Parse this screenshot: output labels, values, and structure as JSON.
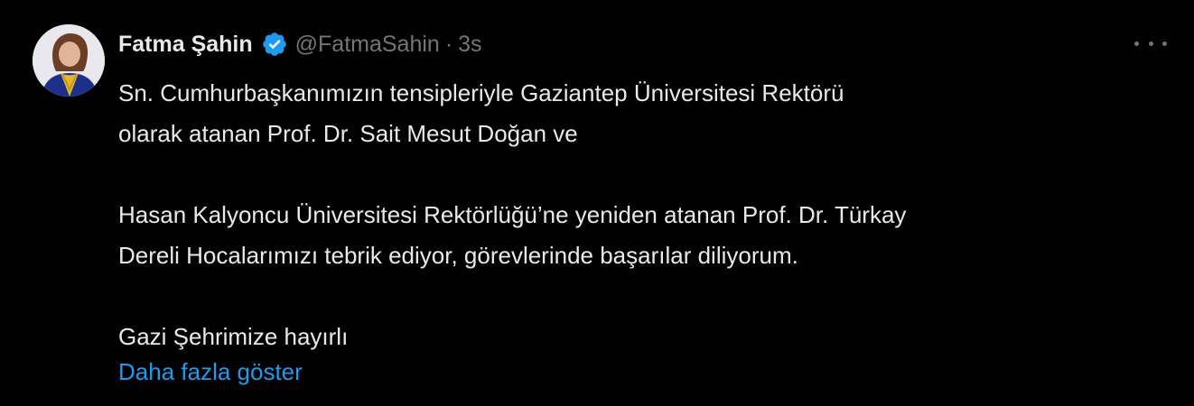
{
  "tweet": {
    "author": {
      "display_name": "Fatma Şahin",
      "handle": "@FatmaSahin",
      "verified": true,
      "separator": "·",
      "time": "3s"
    },
    "text_lines": [
      "Sn. Cumhurbaşkanımızın tensipleriyle Gaziantep Üniversitesi Rektörü",
      "olarak atanan Prof. Dr. Sait Mesut Doğan ve",
      "",
      "Hasan Kalyoncu Üniversitesi Rektörlüğü’ne yeniden atanan Prof. Dr. Türkay",
      "Dereli Hocalarımızı tebrik ediyor, görevlerinde başarılar diliyorum.",
      "",
      "Gazi Şehrimize hayırlı"
    ],
    "show_more_label": "Daha fazla göster",
    "icons": {
      "verified": "verified-badge-icon",
      "more": "more-options-icon"
    },
    "colors": {
      "background": "#000000",
      "text": "#e7e9ea",
      "secondary_text": "#71767b",
      "link": "#1d9bf0",
      "verified_badge": "#1d9bf0"
    }
  }
}
